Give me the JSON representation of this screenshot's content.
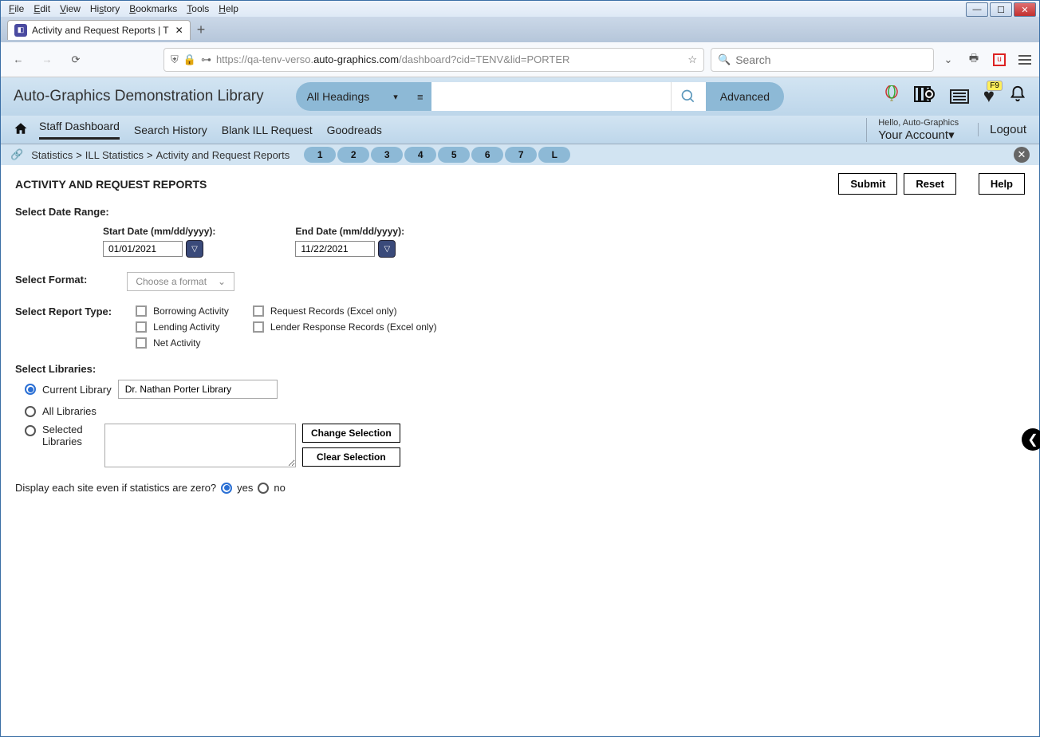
{
  "browser": {
    "menus": {
      "file": "File",
      "edit": "Edit",
      "view": "View",
      "history": "History",
      "bookmarks": "Bookmarks",
      "tools": "Tools",
      "help": "Help"
    },
    "tab_title": "Activity and Request Reports | T",
    "url_prefix": "https://qa-tenv-verso.",
    "url_bold": "auto-graphics.com",
    "url_suffix": "/dashboard?cid=TENV&lid=PORTER",
    "search_placeholder": "Search"
  },
  "app_header": {
    "title": "Auto-Graphics Demonstration Library",
    "select_label": "All Headings",
    "advanced": "Advanced",
    "heart_badge": "F9"
  },
  "nav": {
    "items": {
      "staff": "Staff Dashboard",
      "search": "Search History",
      "blank": "Blank ILL Request",
      "goodreads": "Goodreads"
    },
    "greeting": "Hello, Auto-Graphics",
    "account": "Your Account",
    "logout": "Logout"
  },
  "breadcrumb": {
    "s1": "Statistics",
    "s2": "ILL Statistics",
    "s3": "Activity and Request Reports",
    "pills": [
      "1",
      "2",
      "3",
      "4",
      "5",
      "6",
      "7",
      "L"
    ]
  },
  "page": {
    "title": "ACTIVITY AND REQUEST REPORTS",
    "submit": "Submit",
    "reset": "Reset",
    "help": "Help"
  },
  "form": {
    "date_range_label": "Select Date Range:",
    "start_label": "Start Date (mm/dd/yyyy):",
    "start_value": "01/01/2021",
    "end_label": "End Date (mm/dd/yyyy):",
    "end_value": "11/22/2021",
    "format_label": "Select Format:",
    "format_placeholder": "Choose a format",
    "report_label": "Select Report Type:",
    "report_types": {
      "borrowing": "Borrowing Activity",
      "lending": "Lending Activity",
      "net": "Net Activity",
      "request": "Request Records (Excel only)",
      "lender": "Lender Response Records (Excel only)"
    },
    "libraries_label": "Select Libraries:",
    "current_library_label": "Current Library",
    "current_library_value": "Dr. Nathan Porter Library",
    "all_libraries_label": "All Libraries",
    "selected_libraries_label": "Selected Libraries",
    "change_selection": "Change Selection",
    "clear_selection": "Clear Selection",
    "zero_question": "Display each site even if statistics are zero?",
    "yes": "yes",
    "no": "no"
  }
}
